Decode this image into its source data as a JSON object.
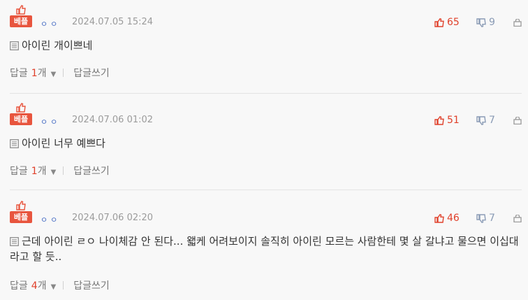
{
  "comments": [
    {
      "badge": "베플",
      "author": "ㅇㅇ",
      "timestamp": "2024.07.05 15:24",
      "likes": "65",
      "dislikes": "9",
      "text": "아이린 개이쁘네",
      "reply_label": "답글",
      "reply_count": "1",
      "reply_unit": "개",
      "write_reply": "답글쓰기"
    },
    {
      "badge": "베플",
      "author": "ㅇㅇ",
      "timestamp": "2024.07.06 01:02",
      "likes": "51",
      "dislikes": "7",
      "text": "아이린 너무 예쁘다",
      "reply_label": "답글",
      "reply_count": "1",
      "reply_unit": "개",
      "write_reply": "답글쓰기"
    },
    {
      "badge": "베플",
      "author": "ㅇㅇ",
      "timestamp": "2024.07.06 02:20",
      "likes": "46",
      "dislikes": "7",
      "text": "근데 아이린 ㄹㅇ 나이체감 안 된다... 왧케 어려보이지 솔직히 아이린 모르는 사람한테 몇 살 갈냐고 물으면 이십대라고 할 듯..",
      "reply_label": "답글",
      "reply_count": "4",
      "reply_unit": "개",
      "write_reply": "답글쓰기"
    }
  ],
  "icons": {
    "badge_icon": "thumbs-up-icon",
    "like_icon": "thumbs-up-icon",
    "dislike_icon": "thumbs-down-icon",
    "report_icon": "lock-icon",
    "text_icon": "document-icon",
    "dropdown_icon": "caret-down-icon"
  },
  "colors": {
    "badge": "#e8553e",
    "like": "#e0402a",
    "dislike": "#8a9bb5",
    "author": "#4a6fc4",
    "reply_count": "#e0402a"
  }
}
